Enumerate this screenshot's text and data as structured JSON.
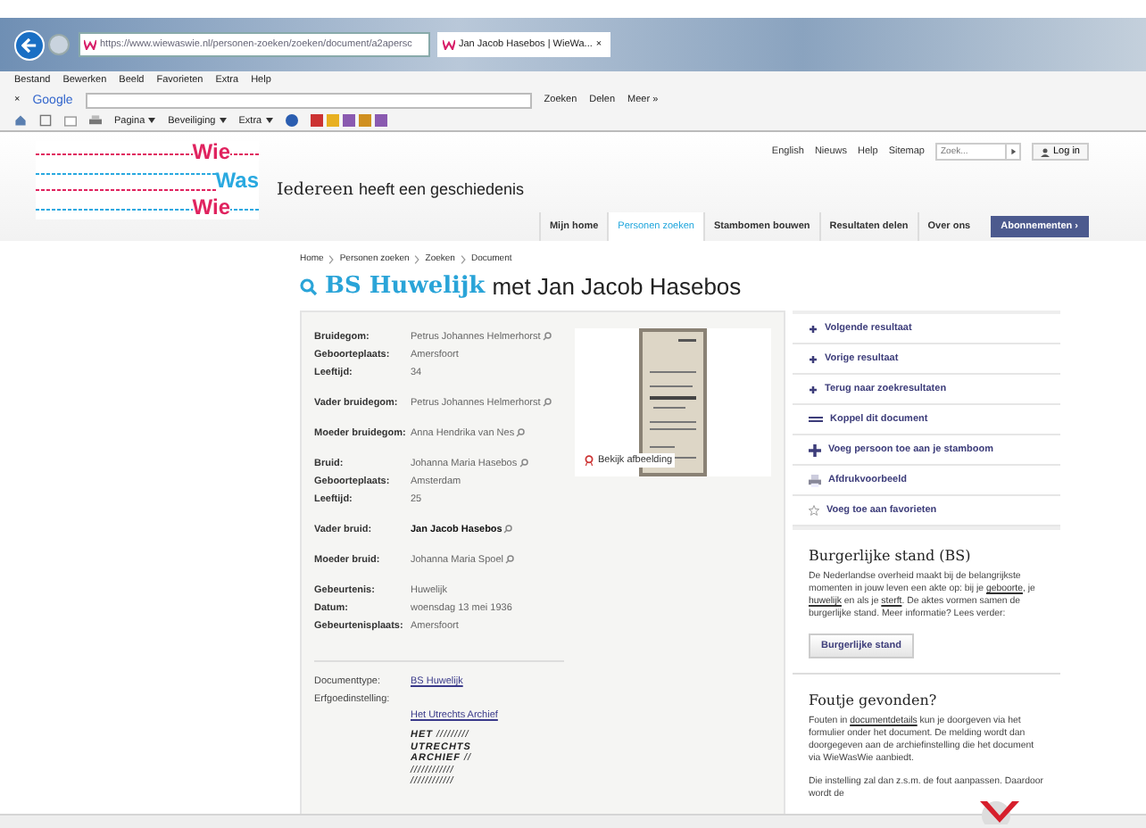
{
  "browser": {
    "address": "https://www.wiewaswie.nl/personen-zoeken/zoeken/document/a2apersc",
    "tab_title": "Jan Jacob Hasebos | WieWa...",
    "tab_close": "×",
    "menu": [
      "Bestand",
      "Bewerken",
      "Beeld",
      "Favorieten",
      "Extra",
      "Help"
    ],
    "google_bar": {
      "close": "×",
      "logo": "Google",
      "search": "Zoeken",
      "share": "Delen",
      "more": "Meer »"
    },
    "command_bar": [
      "Pagina",
      "Beveiliging",
      "Extra"
    ]
  },
  "header": {
    "top_links": [
      "English",
      "Nieuws",
      "Help",
      "Sitemap"
    ],
    "search": {
      "placeholder": "Zoek..."
    },
    "login": "Log in",
    "logo": [
      "Wie",
      "Was",
      "Wie"
    ],
    "tagline_bold": "Iedereen",
    "tagline": "heeft een geschiedenis",
    "nav": [
      {
        "label": "Mijn home",
        "selected": false
      },
      {
        "label": "Personen zoeken",
        "selected": true
      },
      {
        "label": "Stambomen bouwen",
        "selected": false
      },
      {
        "label": "Resultaten delen",
        "selected": false
      },
      {
        "label": "Over ons",
        "selected": false
      }
    ],
    "subscribe": "Abonnementen ›"
  },
  "breadcrumb": [
    "Home",
    "Personen zoeken",
    "Zoeken",
    "Document"
  ],
  "title": {
    "type": "BS Huwelijk",
    "rest": "met Jan Jacob Hasebos"
  },
  "record": {
    "groups": [
      [
        {
          "label": "Bruidegom:",
          "value": "Petrus Johannes Helmerhorst",
          "linked": true,
          "highlighted": false
        },
        {
          "label": "Geboorteplaats:",
          "value": "Amersfoort",
          "linked": false,
          "highlighted": false
        },
        {
          "label": "Leeftijd:",
          "value": "34",
          "linked": false,
          "highlighted": false
        }
      ],
      [
        {
          "label": "Vader bruidegom:",
          "value": "Petrus Johannes Helmerhorst",
          "linked": true,
          "highlighted": false
        }
      ],
      [
        {
          "label": "Moeder bruidegom:",
          "value": "Anna Hendrika van Nes",
          "linked": true,
          "highlighted": false
        }
      ],
      [
        {
          "label": "Bruid:",
          "value": "Johanna Maria Hasebos",
          "linked": true,
          "highlighted": false
        },
        {
          "label": "Geboorteplaats:",
          "value": "Amsterdam",
          "linked": false,
          "highlighted": false
        },
        {
          "label": "Leeftijd:",
          "value": "25",
          "linked": false,
          "highlighted": false
        }
      ],
      [
        {
          "label": "Vader bruid:",
          "value": "Jan Jacob Hasebos",
          "linked": true,
          "highlighted": true
        }
      ],
      [
        {
          "label": "Moeder bruid:",
          "value": "Johanna Maria Spoel",
          "linked": true,
          "highlighted": false
        }
      ],
      [
        {
          "label": "Gebeurtenis:",
          "value": "Huwelijk",
          "linked": false,
          "highlighted": false
        },
        {
          "label": "Datum:",
          "value": "woensdag 13 mei 1936",
          "linked": false,
          "highlighted": false
        },
        {
          "label": "Gebeurtenisplaats:",
          "value": "Amersfoort",
          "linked": false,
          "highlighted": false
        }
      ]
    ],
    "view_image": "Bekijk afbeelding",
    "doc_type_label": "Documenttype:",
    "doc_type": "BS Huwelijk",
    "archive_label": "Erfgoedinstelling:",
    "archive": "Het Utrechts Archief",
    "archive_logo": [
      "**HET** /////////",
      "**UTRECHTS**",
      "**ARCHIEF** //",
      "////////////",
      "////////////"
    ]
  },
  "actions": [
    {
      "kind": "arrow",
      "label": "Volgende resultaat"
    },
    {
      "kind": "arrow",
      "label": "Vorige resultaat"
    },
    {
      "kind": "arrow",
      "label": "Terug naar zoekresultaten"
    },
    {
      "kind": "link",
      "label": "Koppel dit document"
    },
    {
      "kind": "plus",
      "label": "Voeg persoon toe aan je stamboom"
    },
    {
      "kind": "print",
      "label": "Afdrukvoorbeeld"
    },
    {
      "kind": "star",
      "label": "Voeg toe aan favorieten"
    }
  ],
  "info": {
    "title": "Burgerlijke stand (BS)",
    "paragraph": [
      {
        "kind": "text",
        "text": "De Nederlandse overheid maakt bij de belangrijkste momenten in jouw leven een akte op: bij je "
      },
      {
        "kind": "link",
        "text": "geboorte"
      },
      {
        "kind": "text",
        "text": ", je "
      },
      {
        "kind": "link",
        "text": "huwelijk"
      },
      {
        "kind": "text",
        "text": " en als je "
      },
      {
        "kind": "link",
        "text": "sterft"
      },
      {
        "kind": "text",
        "text": ". De aktes vormen samen de burgerlijke stand. Meer informatie? Lees verder:"
      }
    ],
    "button": "Burgerlijke stand"
  },
  "error": {
    "title": "Foutje gevonden?",
    "paragraph": [
      {
        "kind": "text",
        "text": "Fouten in "
      },
      {
        "kind": "link",
        "text": "documentdetails"
      },
      {
        "kind": "text",
        "text": " kun je doorgeven via het formulier onder het document. De melding wordt dan doorgegeven aan de archiefinstelling die het document via WieWasWie aanbiedt."
      }
    ],
    "paragraph_2": "Die instelling zal dan z.s.m. de fout aanpassen. Daardoor wordt de"
  }
}
